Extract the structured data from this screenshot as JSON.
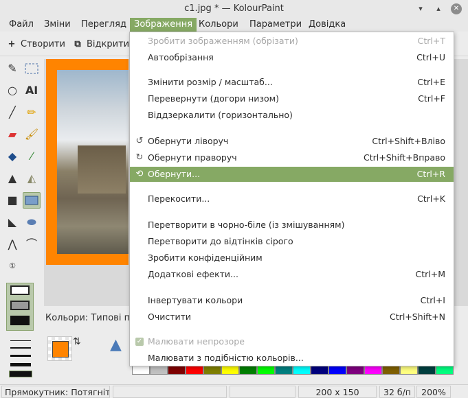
{
  "window": {
    "title": "c1.jpg * — KolourPaint"
  },
  "menubar": [
    "Файл",
    "Зміни",
    "Перегляд",
    "Зображення",
    "Кольори",
    "Параметри",
    "Довідка"
  ],
  "toolbar": {
    "new_label": "Створити",
    "open_label": "Відкрити..."
  },
  "tools": [
    "free-select",
    "rect-select",
    "ellipse",
    "text",
    "line",
    "pencil",
    "eraser",
    "brush",
    "fill",
    "color-picker",
    "spraycan",
    "color-eraser",
    "rectangle",
    "rounded-rect",
    "polygon-tool",
    "ellipse-tool",
    "polyline",
    "curve",
    "zoom-1to1"
  ],
  "canvas": {
    "frame_color": "#ff8400"
  },
  "colors": {
    "label": "Кольори: Типові пар",
    "foreground": "#ff8400",
    "palette": [
      "#ffffff",
      "#c0c0c0",
      "#7f0000",
      "#ff0000",
      "#7f7f00",
      "#ffff00",
      "#007f00",
      "#00ff00",
      "#007f7f",
      "#00ffff",
      "#00007f",
      "#0000ff",
      "#7f007f",
      "#ff00ff",
      "#7f5f00",
      "#ffff7f",
      "#003f3f",
      "#00ff7f"
    ]
  },
  "image_menu": {
    "items": [
      {
        "label": "Зробити зображенням (обрізати)",
        "shortcut": "Ctrl+T",
        "disabled": true
      },
      {
        "label": "Автообрізання",
        "shortcut": "Ctrl+U"
      },
      {
        "label": "Змінити розмір / масштаб...",
        "shortcut": "Ctrl+E"
      },
      {
        "label": "Перевернути (догори низом)",
        "shortcut": "Ctrl+F"
      },
      {
        "label": "Віддзеркалити (горизонтально)",
        "shortcut": ""
      },
      {
        "label": "Обернути ліворуч",
        "shortcut": "Ctrl+Shift+Вліво",
        "icon": "rotate-left-icon"
      },
      {
        "label": "Обернути праворуч",
        "shortcut": "Ctrl+Shift+Вправо",
        "icon": "rotate-right-icon"
      },
      {
        "label": "Обернути...",
        "shortcut": "Ctrl+R",
        "icon": "rotate-icon",
        "highlighted": true
      },
      {
        "label": "Перекосити...",
        "shortcut": "Ctrl+K"
      },
      {
        "label": "Перетворити в чорно-біле (із змішуванням)",
        "shortcut": ""
      },
      {
        "label": "Перетворити до відтінків сірого",
        "shortcut": ""
      },
      {
        "label": "Зробити конфіденційним",
        "shortcut": ""
      },
      {
        "label": "Додаткові ефекти...",
        "shortcut": "Ctrl+M"
      },
      {
        "label": "Інвертувати кольори",
        "shortcut": "Ctrl+I"
      },
      {
        "label": "Очистити",
        "shortcut": "Ctrl+Shift+N"
      },
      {
        "label": "Малювати непрозоре",
        "shortcut": "",
        "disabled": true,
        "checked": true
      },
      {
        "label": "Малювати з подібністю кольорів...",
        "shortcut": ""
      }
    ]
  },
  "statusbar": {
    "message": "Прямокутник: Потягніт...",
    "size": "200 x 150",
    "depth": "32 б/п",
    "zoom": "200%"
  }
}
